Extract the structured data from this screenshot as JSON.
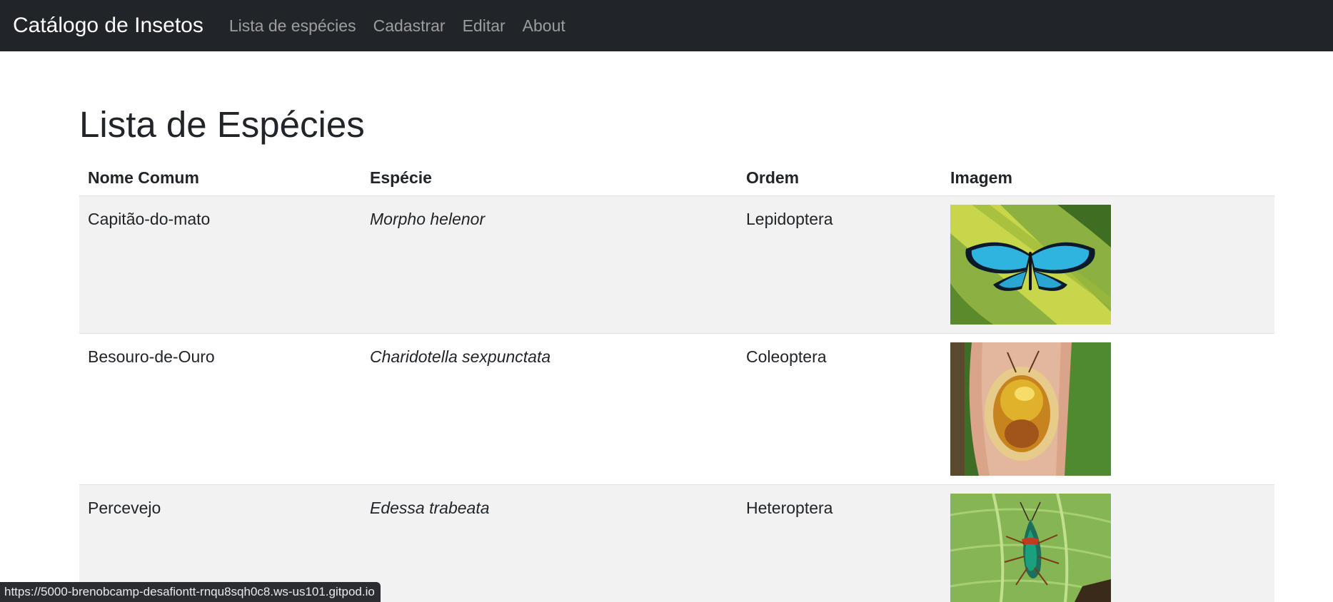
{
  "navbar": {
    "brand": "Catálogo de Insetos",
    "links": [
      "Lista de espécies",
      "Cadastrar",
      "Editar",
      "About"
    ]
  },
  "page": {
    "title": "Lista de Espécies"
  },
  "table": {
    "headers": [
      "Nome Comum",
      "Espécie",
      "Ordem",
      "Imagem"
    ],
    "rows": [
      {
        "common_name": "Capitão-do-mato",
        "species": "Morpho helenor",
        "order": "Lepidoptera",
        "image": "blue-butterfly-photo"
      },
      {
        "common_name": "Besouro-de-Ouro",
        "species": "Charidotella sexpunctata",
        "order": "Coleoptera",
        "image": "golden-beetle-photo"
      },
      {
        "common_name": "Percevejo",
        "species": "Edessa trabeata",
        "order": "Heteroptera",
        "image": "stink-bug-photo"
      }
    ]
  },
  "status_bar": {
    "url": "https://5000-brenobcamp-desafiontt-rnqu8sqh0c8.ws-us101.gitpod.io"
  },
  "colors": {
    "navbar_bg": "#212529",
    "row_stripe": "#f2f2f2",
    "morpho_blue": "#2fb4e0",
    "gold": "#d9a52a",
    "leaf_green": "#86b553"
  }
}
